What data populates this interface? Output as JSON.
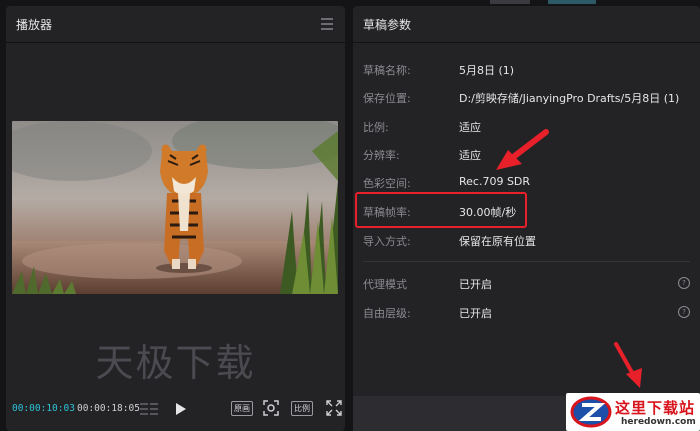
{
  "player": {
    "title": "播放器",
    "watermark": "天极下载",
    "timecode_current": "00:00:10:03",
    "timecode_total": "00:00:18:05",
    "btn_original": "原画",
    "btn_ratio": "比例"
  },
  "draft": {
    "title": "草稿参数",
    "rows": [
      {
        "label": "草稿名称:",
        "value": "5月8日 (1)"
      },
      {
        "label": "保存位置:",
        "value": "D:/剪映存储/JianyingPro Drafts/5月8日 (1)"
      },
      {
        "label": "比例:",
        "value": "适应"
      },
      {
        "label": "分辨率:",
        "value": "适应"
      },
      {
        "label": "色彩空间:",
        "value": "Rec.709 SDR"
      },
      {
        "label": "草稿帧率:",
        "value": "30.00帧/秒"
      },
      {
        "label": "导入方式:",
        "value": "保留在原有位置"
      },
      {
        "label": "代理模式",
        "value": "已开启"
      },
      {
        "label": "自由层级:",
        "value": "已开启"
      }
    ]
  },
  "logo": {
    "title": "这里下载站",
    "url": "heredown.com"
  },
  "colors": {
    "accent": "#2cc2d8",
    "highlight": "#e8202a",
    "panel_bg": "#232326"
  }
}
